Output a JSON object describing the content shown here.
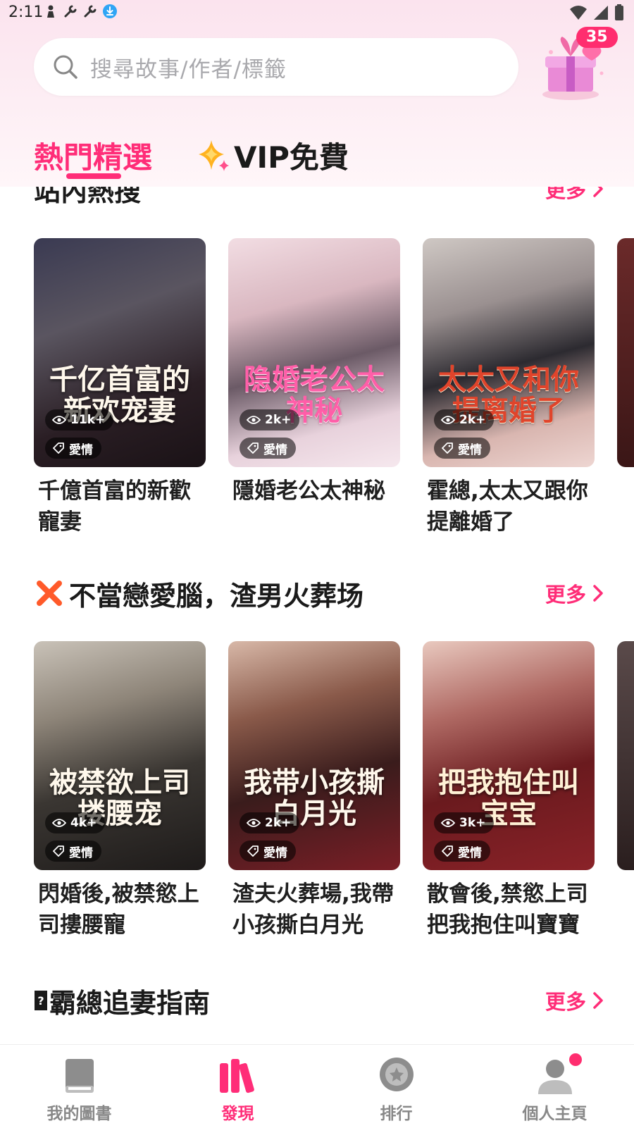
{
  "status_bar": {
    "time": "2:11",
    "icons": [
      "person-icon",
      "wrench-icon",
      "wrench-icon",
      "download-icon"
    ],
    "right_icons": [
      "wifi-icon",
      "signal-icon",
      "battery-icon"
    ]
  },
  "search": {
    "placeholder": "搜尋故事/作者/標籤",
    "icon": "search-icon"
  },
  "gift": {
    "badge": "35",
    "icon": "gift-box-icon"
  },
  "tabs": [
    {
      "label": "熱門精選",
      "active": true
    },
    {
      "label": "VIP免費",
      "active": false,
      "icon": "sparkle-icon"
    }
  ],
  "sections": [
    {
      "title": "站內熱搜",
      "more": "更多",
      "books": [
        {
          "cover_title": "千亿首富的新欢宠妻",
          "views": "11k+",
          "tag": "愛情",
          "title": "千億首富的新歡寵妻"
        },
        {
          "cover_title": "隐婚老公太神秘",
          "views": "2k+",
          "tag": "愛情",
          "title": "隱婚老公太神秘"
        },
        {
          "cover_title": "太太又和你提离婚了",
          "views": "2k+",
          "tag": "愛情",
          "title": "霍總,太太又跟你提離婚了"
        }
      ]
    },
    {
      "title": "不當戀愛腦，渣男火葬场",
      "title_icon": "cross-icon",
      "more": "更多",
      "books": [
        {
          "cover_title": "被禁欲上司搂腰宠",
          "views": "4k+",
          "tag": "愛情",
          "title": "閃婚後,被禁慾上司摟腰寵"
        },
        {
          "cover_title": "我带小孩撕白月光",
          "views": "2k+",
          "tag": "愛情",
          "title": "渣夫火葬場,我帶小孩撕白月光"
        },
        {
          "cover_title": "把我抱住叫宝宝",
          "views": "3k+",
          "tag": "愛情",
          "title": "散會後,禁慾上司把我抱住叫寶寶"
        }
      ]
    },
    {
      "title": "霸總追妻指南",
      "more": "更多"
    }
  ],
  "bottom_nav": [
    {
      "label": "我的圖書",
      "icon": "book-icon",
      "active": false
    },
    {
      "label": "發現",
      "icon": "bookshelf-icon",
      "active": true
    },
    {
      "label": "排行",
      "icon": "rank-medal-icon",
      "active": false
    },
    {
      "label": "個人主頁",
      "icon": "profile-icon",
      "active": false,
      "dot": true
    }
  ],
  "colors": {
    "accent": "#ff2d78",
    "badge": "#ff2d6f"
  }
}
